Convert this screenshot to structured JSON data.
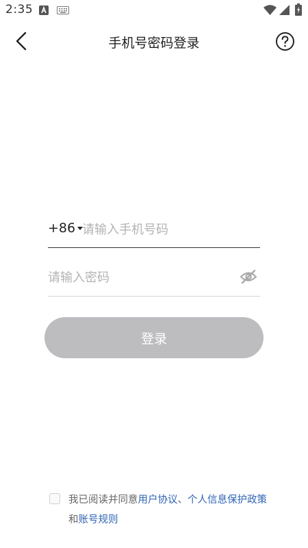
{
  "status_bar": {
    "time": "2:35",
    "icons": [
      "a-notification-icon",
      "keyboard-icon",
      "wifi-icon",
      "signal-icon",
      "battery-icon"
    ]
  },
  "header": {
    "title": "手机号密码登录",
    "back_icon": "chevron-left-icon",
    "help_icon": "help-circle-icon"
  },
  "form": {
    "country_code": "+86",
    "phone_value": "",
    "phone_placeholder": "请输入手机号码",
    "password_value": "",
    "password_placeholder": "请输入密码",
    "password_toggle_icon": "eye-off-icon",
    "login_label": "登录"
  },
  "agreement": {
    "checked": false,
    "prefix": "我已阅读并同意",
    "user_agreement": "用户协议",
    "separator": "、",
    "privacy_policy": "个人信息保护政策",
    "conjunction": "和",
    "account_rules": "账号规则"
  },
  "colors": {
    "background": "#ffffff",
    "text_primary": "#222222",
    "placeholder": "#b3b3b3",
    "button_disabled": "#bdbdc0",
    "link": "#2f64b4",
    "muted_text": "#666666"
  }
}
